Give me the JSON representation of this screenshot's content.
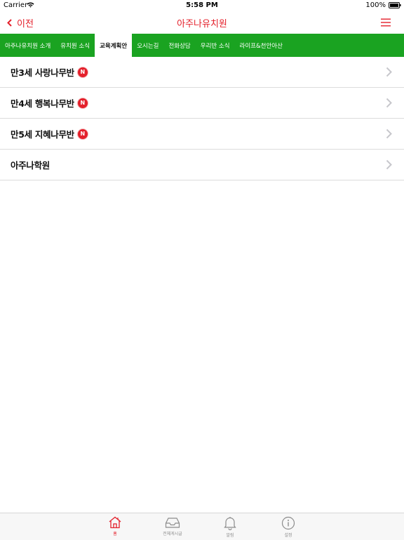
{
  "status_bar": {
    "carrier": "Carrier",
    "time": "5:58 PM",
    "battery": "100%"
  },
  "nav": {
    "back_label": "이전",
    "title": "아주나유치원",
    "accent_color": "#e4202b"
  },
  "tabs": [
    {
      "label": "아주나유치원 소개",
      "active": false
    },
    {
      "label": "유치원 소식",
      "active": false
    },
    {
      "label": "교육계획안",
      "active": true
    },
    {
      "label": "오시는길",
      "active": false
    },
    {
      "label": "전화상담",
      "active": false
    },
    {
      "label": "우리반 소식",
      "active": false
    },
    {
      "label": "라이프&천안아산",
      "active": false
    }
  ],
  "tab_bar_color": "#1aa321",
  "list": {
    "new_badge": "N",
    "items": [
      {
        "label": "만3세 사랑나무반",
        "is_new": true
      },
      {
        "label": "만4세 행복나무반",
        "is_new": true
      },
      {
        "label": "만5세 지혜나무반",
        "is_new": true
      },
      {
        "label": "아주나학원",
        "is_new": false
      }
    ]
  },
  "bottom_tabs": [
    {
      "label": "홈",
      "icon": "home-icon",
      "active": true
    },
    {
      "label": "전체게시글",
      "icon": "inbox-icon",
      "active": false
    },
    {
      "label": "알림",
      "icon": "bell-icon",
      "active": false
    },
    {
      "label": "설정",
      "icon": "info-icon",
      "active": false
    }
  ]
}
